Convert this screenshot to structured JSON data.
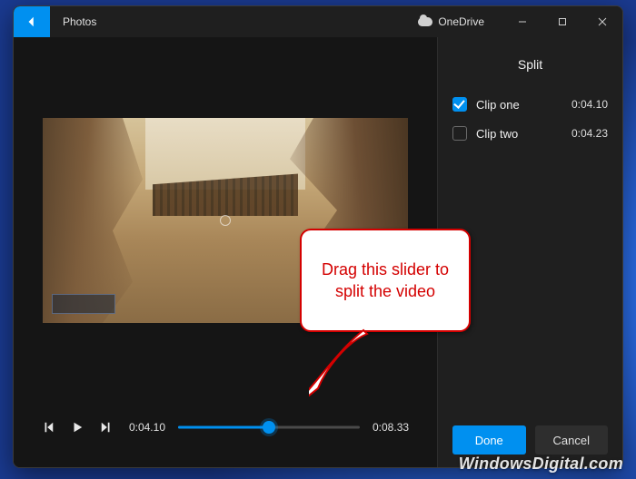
{
  "app": {
    "title": "Photos"
  },
  "titlebar": {
    "onedrive_label": "OneDrive"
  },
  "player": {
    "current_time": "0:04.10",
    "total_time": "0:08.33",
    "progress_pct": 50
  },
  "side": {
    "title": "Split",
    "clips": [
      {
        "label": "Clip one",
        "time": "0:04.10",
        "selected": true
      },
      {
        "label": "Clip two",
        "time": "0:04.23",
        "selected": false
      }
    ],
    "done_label": "Done",
    "cancel_label": "Cancel"
  },
  "callout": {
    "text": "Drag this slider to split the video"
  },
  "watermark": {
    "text": "WindowsDigital.com"
  },
  "colors": {
    "accent": "#0090f0",
    "callout_border": "#d40000"
  }
}
